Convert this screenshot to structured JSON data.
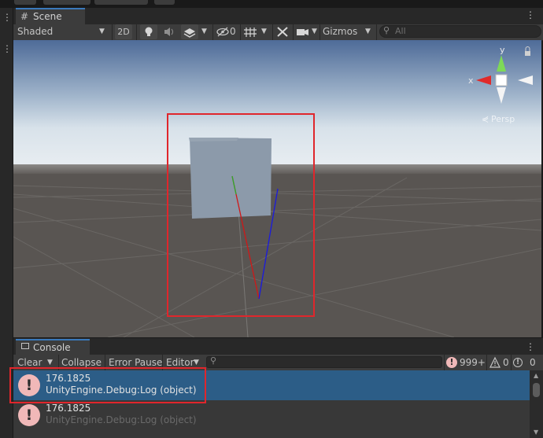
{
  "scene": {
    "tab_label": "Scene",
    "shading_mode": "Shaded",
    "mode_2d": "2D",
    "hidden_count": "0",
    "gizmos_label": "Gizmos",
    "search_placeholder": "All",
    "persp_label": "Persp",
    "axis_x": "x",
    "axis_y": "y"
  },
  "console": {
    "tab_label": "Console",
    "clear_label": "Clear",
    "collapse_label": "Collapse",
    "error_pause_label": "Error Pause",
    "editor_label": "Editor",
    "error_count": "999+",
    "warning_count": "0",
    "info_count": "0",
    "entries": [
      {
        "message": "176.1825",
        "detail": "UnityEngine.Debug:Log (object)",
        "selected": true
      },
      {
        "message": "176.1825",
        "detail": "UnityEngine.Debug:Log (object)",
        "selected": false
      }
    ]
  },
  "colors": {
    "accent_tab": "#3a79bb",
    "selection": "#2c5d87",
    "annotation": "#e0262c",
    "error_badge": "#f0b8b8"
  },
  "icons": [
    "hash-icon",
    "dropdown-icon",
    "lightbulb-icon",
    "audio-icon",
    "effects-icon",
    "visibility-icon",
    "grid-icon",
    "tools-icon",
    "camera-icon",
    "search-icon",
    "console-icon",
    "error-icon",
    "warning-icon",
    "info-icon",
    "menu-icon",
    "lock-icon"
  ]
}
